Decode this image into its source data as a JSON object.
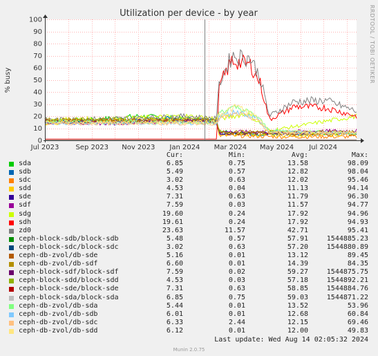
{
  "chart_data": {
    "type": "line",
    "title": "Utilization per device - by year",
    "ylabel": "% busy",
    "ylim": [
      0,
      100
    ],
    "y_ticks": [
      0,
      10,
      20,
      30,
      40,
      50,
      60,
      70,
      80,
      90,
      100
    ],
    "x_ticks": [
      "Jul 2023",
      "Sep 2023",
      "Nov 2023",
      "Jan 2024",
      "Mar 2024",
      "May 2024",
      "Jul 2024"
    ],
    "x_range": [
      "2023-07-01",
      "2024-08-14"
    ],
    "grid": true,
    "background": "#ffffff",
    "grid_color": "#ffb0b0",
    "now_line_date": "2024-01-27",
    "series": [
      {
        "name": "sda",
        "color": "#00cc00",
        "values": [
          [
            0.0,
            16
          ],
          [
            0.15,
            17
          ],
          [
            0.3,
            20
          ],
          [
            0.45,
            18
          ],
          [
            0.55,
            16
          ],
          [
            0.56,
            8
          ],
          [
            0.63,
            6
          ],
          [
            0.75,
            5
          ],
          [
            1.0,
            6
          ]
        ]
      },
      {
        "name": "sdb",
        "color": "#0066b3",
        "values": [
          [
            0.0,
            15
          ],
          [
            0.2,
            16
          ],
          [
            0.4,
            18
          ],
          [
            0.55,
            16
          ],
          [
            0.56,
            6
          ],
          [
            0.7,
            5
          ],
          [
            1.0,
            6
          ]
        ]
      },
      {
        "name": "sdc",
        "color": "#ff8000",
        "values": [
          [
            0.0,
            15
          ],
          [
            0.25,
            16
          ],
          [
            0.45,
            17
          ],
          [
            0.55,
            15
          ],
          [
            0.56,
            4
          ],
          [
            0.75,
            3
          ],
          [
            1.0,
            3
          ]
        ]
      },
      {
        "name": "sdd",
        "color": "#ffcc00",
        "values": [
          [
            0.0,
            14
          ],
          [
            0.25,
            15
          ],
          [
            0.45,
            17
          ],
          [
            0.55,
            14
          ],
          [
            0.56,
            5
          ],
          [
            0.75,
            4
          ],
          [
            1.0,
            5
          ]
        ]
      },
      {
        "name": "sde",
        "color": "#330099",
        "values": [
          [
            0.0,
            16
          ],
          [
            0.2,
            15
          ],
          [
            0.45,
            17
          ],
          [
            0.55,
            15
          ],
          [
            0.56,
            6
          ],
          [
            0.75,
            6
          ],
          [
            1.0,
            7
          ]
        ]
      },
      {
        "name": "sdf",
        "color": "#990099",
        "values": [
          [
            0.0,
            15
          ],
          [
            0.2,
            14
          ],
          [
            0.45,
            16
          ],
          [
            0.55,
            14
          ],
          [
            0.56,
            7
          ],
          [
            0.75,
            7
          ],
          [
            1.0,
            8
          ]
        ]
      },
      {
        "name": "sdg",
        "color": "#ccff00",
        "values": [
          [
            0.0,
            17
          ],
          [
            0.25,
            18
          ],
          [
            0.45,
            20
          ],
          [
            0.55,
            18
          ],
          [
            0.56,
            18
          ],
          [
            0.65,
            22
          ],
          [
            0.72,
            8
          ],
          [
            1.0,
            20
          ]
        ]
      },
      {
        "name": "sdh",
        "color": "#ff0000",
        "values": [
          [
            0.0,
            1
          ],
          [
            0.55,
            1
          ],
          [
            0.56,
            45
          ],
          [
            0.6,
            66
          ],
          [
            0.66,
            62
          ],
          [
            0.69,
            48
          ],
          [
            0.72,
            17
          ],
          [
            0.8,
            28
          ],
          [
            0.9,
            27
          ],
          [
            1.0,
            20
          ]
        ]
      },
      {
        "name": "zd0",
        "color": "#808080",
        "values": [
          [
            0.0,
            17
          ],
          [
            0.25,
            18
          ],
          [
            0.45,
            20
          ],
          [
            0.55,
            18
          ],
          [
            0.56,
            48
          ],
          [
            0.6,
            70
          ],
          [
            0.66,
            68
          ],
          [
            0.69,
            52
          ],
          [
            0.72,
            20
          ],
          [
            0.8,
            32
          ],
          [
            0.9,
            33
          ],
          [
            1.0,
            24
          ]
        ]
      },
      {
        "name": "ceph-block-sdb/block-sdb",
        "color": "#008f00",
        "values": [
          [
            0.0,
            0.5
          ],
          [
            1.0,
            0.5
          ]
        ]
      },
      {
        "name": "ceph-block-sdc/block-sdc",
        "color": "#00487d",
        "values": [
          [
            0.0,
            0.5
          ],
          [
            1.0,
            0.5
          ]
        ]
      },
      {
        "name": "ceph-db-zvol/db-sde",
        "color": "#b35a00",
        "values": [
          [
            0.0,
            16
          ],
          [
            0.55,
            16
          ],
          [
            0.56,
            6
          ],
          [
            1.0,
            5
          ]
        ]
      },
      {
        "name": "ceph-db-zvol/db-sdf",
        "color": "#b38f00",
        "values": [
          [
            0.0,
            17
          ],
          [
            0.55,
            17
          ],
          [
            0.56,
            7
          ],
          [
            1.0,
            7
          ]
        ]
      },
      {
        "name": "ceph-block-sdf/block-sdf",
        "color": "#6b006b",
        "values": [
          [
            0.0,
            0.5
          ],
          [
            1.0,
            0.5
          ]
        ]
      },
      {
        "name": "ceph-block-sdd/block-sdd",
        "color": "#8fb300",
        "values": [
          [
            0.0,
            0.5
          ],
          [
            1.0,
            0.5
          ]
        ]
      },
      {
        "name": "ceph-block-sde/block-sde",
        "color": "#b30000",
        "values": [
          [
            0.0,
            0.5
          ],
          [
            1.0,
            0.5
          ]
        ]
      },
      {
        "name": "ceph-block-sda/block-sda",
        "color": "#bebebe",
        "values": [
          [
            0.0,
            0.5
          ],
          [
            1.0,
            0.5
          ]
        ]
      },
      {
        "name": "ceph-db-zvol/db-sda",
        "color": "#80ff80",
        "values": [
          [
            0.0,
            15
          ],
          [
            0.55,
            15
          ],
          [
            0.56,
            24
          ],
          [
            0.62,
            27
          ],
          [
            0.68,
            20
          ],
          [
            0.72,
            8
          ],
          [
            1.0,
            6
          ]
        ]
      },
      {
        "name": "ceph-db-zvol/db-sdb",
        "color": "#80c9ff",
        "values": [
          [
            0.0,
            14
          ],
          [
            0.55,
            14
          ],
          [
            0.56,
            20
          ],
          [
            0.62,
            24
          ],
          [
            0.68,
            18
          ],
          [
            0.72,
            7
          ],
          [
            1.0,
            6
          ]
        ]
      },
      {
        "name": "ceph-db-zvol/db-sdc",
        "color": "#ffc080",
        "values": [
          [
            0.0,
            14
          ],
          [
            0.55,
            14
          ],
          [
            0.56,
            18
          ],
          [
            0.62,
            22
          ],
          [
            0.68,
            17
          ],
          [
            0.72,
            6
          ],
          [
            1.0,
            6
          ]
        ]
      },
      {
        "name": "ceph-db-zvol/db-sdd",
        "color": "#ffe680",
        "values": [
          [
            0.0,
            15
          ],
          [
            0.55,
            15
          ],
          [
            0.56,
            22
          ],
          [
            0.62,
            28
          ],
          [
            0.68,
            19
          ],
          [
            0.72,
            7
          ],
          [
            1.0,
            6
          ]
        ]
      }
    ]
  },
  "legend": {
    "headers": {
      "cur": "Cur:",
      "min": "Min:",
      "avg": "Avg:",
      "max": "Max:"
    },
    "rows": [
      {
        "name": "sda",
        "cur": "6.85",
        "min": "0.75",
        "avg": "13.58",
        "max": "98.09"
      },
      {
        "name": "sdb",
        "cur": "5.49",
        "min": "0.57",
        "avg": "12.82",
        "max": "98.04"
      },
      {
        "name": "sdc",
        "cur": "3.02",
        "min": "0.63",
        "avg": "12.02",
        "max": "95.46"
      },
      {
        "name": "sdd",
        "cur": "4.53",
        "min": "0.04",
        "avg": "11.13",
        "max": "94.14"
      },
      {
        "name": "sde",
        "cur": "7.31",
        "min": "0.63",
        "avg": "11.79",
        "max": "96.30"
      },
      {
        "name": "sdf",
        "cur": "7.59",
        "min": "0.03",
        "avg": "11.57",
        "max": "94.77"
      },
      {
        "name": "sdg",
        "cur": "19.60",
        "min": "0.24",
        "avg": "17.92",
        "max": "94.96"
      },
      {
        "name": "sdh",
        "cur": "19.61",
        "min": "0.24",
        "avg": "17.92",
        "max": "94.93"
      },
      {
        "name": "zd0",
        "cur": "23.63",
        "min": "11.57",
        "avg": "42.71",
        "max": "95.41"
      },
      {
        "name": "ceph-block-sdb/block-sdb",
        "cur": "5.48",
        "min": "0.57",
        "avg": "57.91",
        "max": "1544885.23"
      },
      {
        "name": "ceph-block-sdc/block-sdc",
        "cur": "3.02",
        "min": "0.63",
        "avg": "57.20",
        "max": "1544880.89"
      },
      {
        "name": "ceph-db-zvol/db-sde",
        "cur": "5.16",
        "min": "0.01",
        "avg": "13.12",
        "max": "89.45"
      },
      {
        "name": "ceph-db-zvol/db-sdf",
        "cur": "6.60",
        "min": "0.01",
        "avg": "14.39",
        "max": "84.35"
      },
      {
        "name": "ceph-block-sdf/block-sdf",
        "cur": "7.59",
        "min": "0.02",
        "avg": "59.27",
        "max": "1544875.75"
      },
      {
        "name": "ceph-block-sdd/block-sdd",
        "cur": "4.53",
        "min": "0.03",
        "avg": "57.18",
        "max": "1544892.21"
      },
      {
        "name": "ceph-block-sde/block-sde",
        "cur": "7.31",
        "min": "0.63",
        "avg": "58.85",
        "max": "1544884.76"
      },
      {
        "name": "ceph-block-sda/block-sda",
        "cur": "6.85",
        "min": "0.75",
        "avg": "59.03",
        "max": "1544871.22"
      },
      {
        "name": "ceph-db-zvol/db-sda",
        "cur": "5.44",
        "min": "0.01",
        "avg": "13.52",
        "max": "53.96"
      },
      {
        "name": "ceph-db-zvol/db-sdb",
        "cur": "6.01",
        "min": "0.01",
        "avg": "12.68",
        "max": "60.84"
      },
      {
        "name": "ceph-db-zvol/db-sdc",
        "cur": "6.33",
        "min": "2.44",
        "avg": "12.15",
        "max": "69.46"
      },
      {
        "name": "ceph-db-zvol/db-sdd",
        "cur": "6.12",
        "min": "0.01",
        "avg": "12.00",
        "max": "49.83"
      }
    ]
  },
  "footer": {
    "last_update": "Last update: Wed Aug 14 02:05:32 2024",
    "version": "Munin 2.0.75"
  },
  "side_label": "RRDTOOL / TOBI OETIKER"
}
